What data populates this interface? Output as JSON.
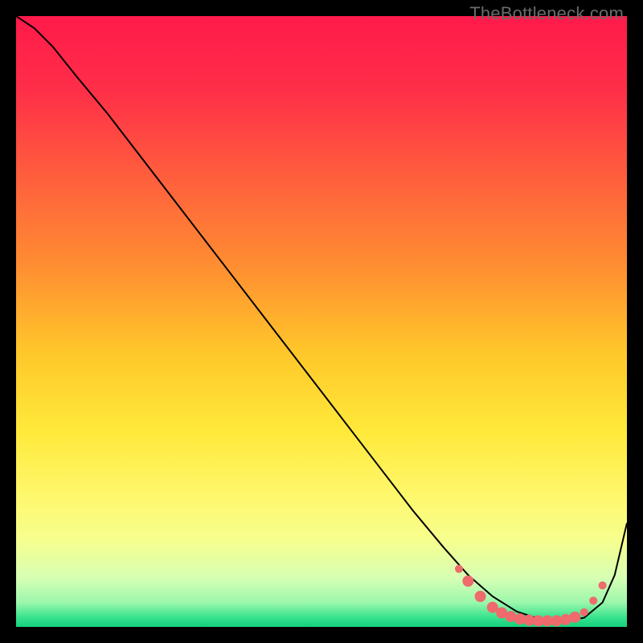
{
  "watermark": "TheBottleneck.com",
  "chart_data": {
    "type": "line",
    "title": "",
    "xlabel": "",
    "ylabel": "",
    "xlim": [
      0,
      100
    ],
    "ylim": [
      0,
      100
    ],
    "grid": false,
    "legend": false,
    "background_gradient": {
      "stops": [
        {
          "offset": 0.0,
          "color": "#ff1a4b"
        },
        {
          "offset": 0.12,
          "color": "#ff2e48"
        },
        {
          "offset": 0.25,
          "color": "#ff5a3e"
        },
        {
          "offset": 0.4,
          "color": "#ff8a32"
        },
        {
          "offset": 0.55,
          "color": "#ffc72a"
        },
        {
          "offset": 0.68,
          "color": "#ffe93a"
        },
        {
          "offset": 0.78,
          "color": "#fff76a"
        },
        {
          "offset": 0.86,
          "color": "#f6ff8f"
        },
        {
          "offset": 0.92,
          "color": "#d6ffb4"
        },
        {
          "offset": 0.96,
          "color": "#9bf7ac"
        },
        {
          "offset": 0.985,
          "color": "#36e28d"
        },
        {
          "offset": 1.0,
          "color": "#14d07c"
        }
      ]
    },
    "series": [
      {
        "name": "bottleneck-curve",
        "color": "#000000",
        "stroke_width": 2,
        "x": [
          0,
          3,
          6,
          10,
          15,
          20,
          25,
          30,
          35,
          40,
          45,
          50,
          55,
          60,
          65,
          70,
          74,
          78,
          82,
          86,
          90,
          93,
          96,
          98,
          100
        ],
        "y": [
          100,
          98,
          95,
          90,
          84,
          77.5,
          71,
          64.5,
          58,
          51.5,
          45,
          38.5,
          32,
          25.5,
          19,
          13,
          8.5,
          5,
          2.5,
          1.2,
          1,
          1.5,
          4,
          8.5,
          17
        ]
      }
    ],
    "markers": {
      "name": "optimum-points",
      "color": "#ee6a6c",
      "radius_small": 5,
      "radius_large": 7,
      "points": [
        {
          "x": 72.5,
          "y": 9.5,
          "r": "small"
        },
        {
          "x": 74.0,
          "y": 7.5,
          "r": "large"
        },
        {
          "x": 76.0,
          "y": 5.0,
          "r": "large"
        },
        {
          "x": 78.0,
          "y": 3.2,
          "r": "large"
        },
        {
          "x": 79.5,
          "y": 2.3,
          "r": "large"
        },
        {
          "x": 81.0,
          "y": 1.7,
          "r": "large"
        },
        {
          "x": 82.5,
          "y": 1.3,
          "r": "large"
        },
        {
          "x": 84.0,
          "y": 1.1,
          "r": "large"
        },
        {
          "x": 85.5,
          "y": 1.0,
          "r": "large"
        },
        {
          "x": 87.0,
          "y": 1.0,
          "r": "large"
        },
        {
          "x": 88.5,
          "y": 1.0,
          "r": "large"
        },
        {
          "x": 90.0,
          "y": 1.2,
          "r": "large"
        },
        {
          "x": 91.5,
          "y": 1.6,
          "r": "large"
        },
        {
          "x": 93.0,
          "y": 2.4,
          "r": "small"
        },
        {
          "x": 94.5,
          "y": 4.3,
          "r": "small"
        },
        {
          "x": 96.0,
          "y": 6.8,
          "r": "small"
        }
      ]
    }
  }
}
